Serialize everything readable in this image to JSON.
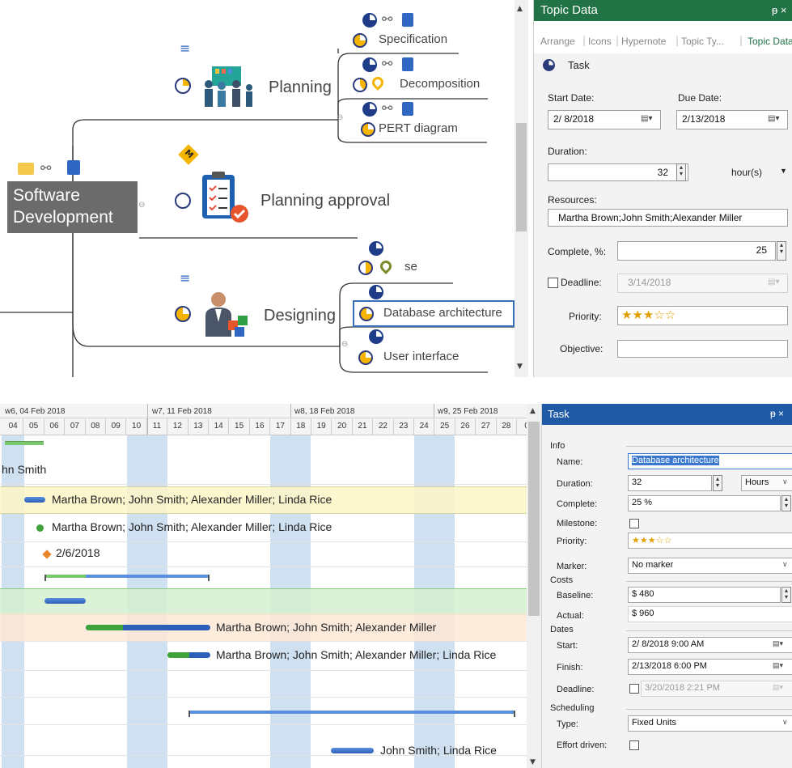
{
  "mindmap": {
    "central": {
      "line1": "Software",
      "line2": "Development"
    },
    "planning": {
      "label": "Planning"
    },
    "specification": {
      "label": "Specification"
    },
    "decomposition": {
      "label": "Decomposition"
    },
    "pert": {
      "label": "PERT diagram"
    },
    "milestone_marker": "M",
    "planning_approval": {
      "label": "Planning approval"
    },
    "designing": {
      "label": "Designing"
    },
    "se": {
      "label": "se"
    },
    "database": {
      "label": "Database architecture"
    },
    "ui": {
      "label": "User interface"
    }
  },
  "topic_panel": {
    "title": "Topic Data",
    "pin": "ᵽ ×",
    "tabs": [
      "Arrange",
      "Icons",
      "Hypernote",
      "Topic Ty...",
      "Topic Data"
    ],
    "section": "Task",
    "start_label": "Start Date:",
    "start_value": "2/ 8/2018",
    "due_label": "Due Date:",
    "due_value": "2/13/2018",
    "duration_label": "Duration:",
    "duration_value": "32",
    "duration_unit": "hour(s)",
    "resources_label": "Resources:",
    "resources_value": "Martha Brown;John Smith;Alexander Miller",
    "complete_label": "Complete, %:",
    "complete_value": "25",
    "deadline_label": "Deadline:",
    "deadline_value": "3/14/2018",
    "priority_label": "Priority:",
    "priority_stars": "★★★☆☆",
    "objective_label": "Objective:"
  },
  "gantt": {
    "weeks": [
      "w6, 04 Feb 2018",
      "w7, 11 Feb 2018",
      "w8, 18 Feb 2018",
      "w9, 25 Feb 2018"
    ],
    "days": [
      "04",
      "05",
      "06",
      "07",
      "08",
      "09",
      "10",
      "11",
      "12",
      "13",
      "14",
      "15",
      "16",
      "17",
      "18",
      "19",
      "20",
      "21",
      "22",
      "23",
      "24",
      "25",
      "26",
      "27",
      "28",
      "0"
    ],
    "rows": [
      {
        "label": "hn Smith"
      },
      {
        "label": "Martha Brown; John Smith; Alexander Miller; Linda Rice"
      },
      {
        "label": "Martha Brown; John Smith; Alexander Miller; Linda Rice"
      },
      {
        "label": "2/6/2018"
      },
      {
        "label": "Martha Brown; John Smith; Alexander Miller"
      },
      {
        "label": "Martha Brown; John Smith; Alexander Miller; Linda Rice"
      },
      {
        "label": "John Smith; Linda Rice"
      }
    ],
    "progress": {
      "task_row7": 0.3,
      "task_row8": 0.5
    }
  },
  "task_panel": {
    "title": "Task",
    "pin": "ᵽ ×",
    "info_label": "Info",
    "name_label": "Name:",
    "name_value": "Database architecture",
    "duration_label": "Duration:",
    "duration_value": "32",
    "duration_unit": "Hours",
    "complete_label": "Complete:",
    "complete_value": "25 %",
    "milestone_label": "Milestone:",
    "priority_label": "Priority:",
    "priority_stars": "★★★☆☆",
    "marker_label": "Marker:",
    "marker_value": "No marker",
    "costs_label": "Costs",
    "baseline_label": "Baseline:",
    "baseline_value": "$ 480",
    "actual_label": "Actual:",
    "actual_value": "$ 960",
    "dates_label": "Dates",
    "start_label": "Start:",
    "start_value": "2/ 8/2018  9:00 AM",
    "finish_label": "Finish:",
    "finish_value": "2/13/2018  6:00 PM",
    "deadline_label": "Deadline:",
    "deadline_value": "3/20/2018  2:21 PM",
    "scheduling_label": "Scheduling",
    "type_label": "Type:",
    "type_value": "Fixed Units",
    "effort_label": "Effort driven:"
  },
  "colors": {
    "panel_green": "#217346",
    "panel_blue": "#1f5aa6",
    "central_topic": "#6b6b6b",
    "weekend": "#cfe0f1",
    "row_yellow": "#fdf6c8",
    "row_green": "#d7f0cf",
    "row_peach": "#fde9d6"
  }
}
